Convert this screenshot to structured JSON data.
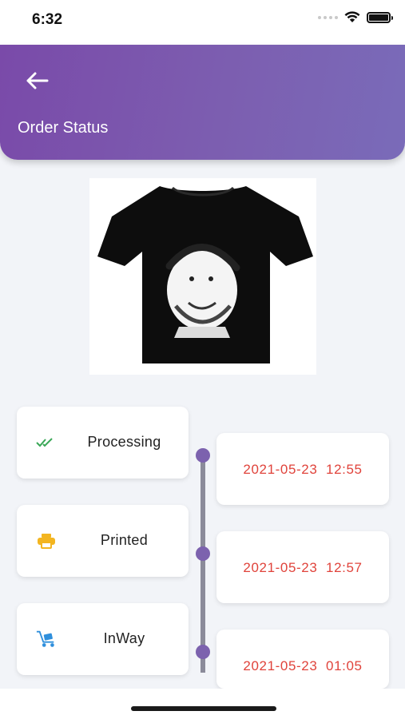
{
  "status_bar": {
    "time": "6:32",
    "icons": [
      "cellular-signal-icon",
      "wifi-icon",
      "battery-icon"
    ],
    "battery_level": 1.0
  },
  "header": {
    "back_icon": "arrow-left-icon",
    "title": "Order Status",
    "gradient_colors": [
      "#7a4aa9",
      "#7a6bb9"
    ]
  },
  "product": {
    "image_description_icon": "t-shirt-image"
  },
  "colors": {
    "accent": "#7c62ae",
    "timestamp": "#e0433b",
    "timeline_line": "#8b8b9a",
    "processing_icon": "#3aa757",
    "printed_icon": "#f3b520",
    "inway_icon": "#2f8fdc"
  },
  "timeline": [
    {
      "status": "Processing",
      "icon": "double-check-icon",
      "timestamp": "2021-05-23  12:55"
    },
    {
      "status": "Printed",
      "icon": "printer-icon",
      "timestamp": "2021-05-23  12:57"
    },
    {
      "status": "InWay",
      "icon": "delivery-cart-icon",
      "timestamp": "2021-05-23  01:05"
    }
  ]
}
